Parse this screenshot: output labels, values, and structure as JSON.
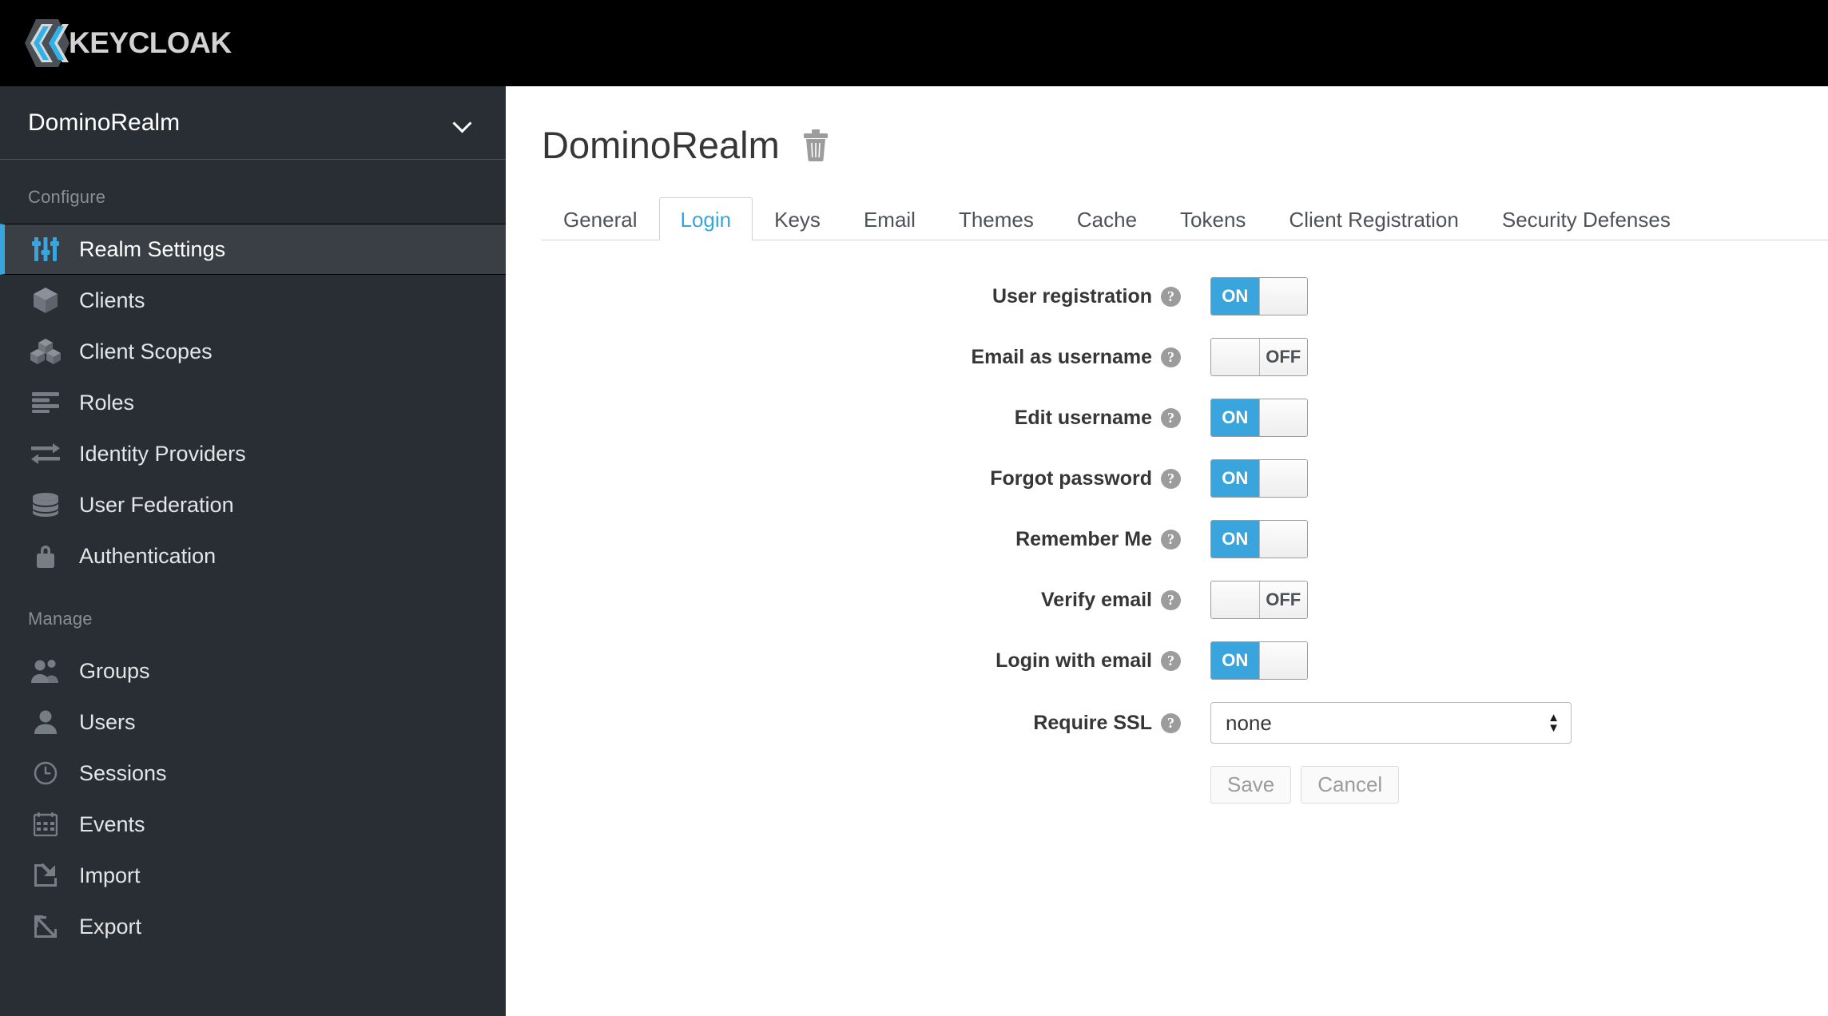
{
  "brand": {
    "name": "KEYCLOAK",
    "logo_icon": "keycloak-hexagon-logo"
  },
  "sidebar": {
    "realm_selector": {
      "label": "DominoRealm",
      "chevron_icon": "chevron-down-icon"
    },
    "sections": [
      {
        "title": "Configure",
        "items": [
          {
            "label": "Realm Settings",
            "icon": "sliders-icon",
            "active": true
          },
          {
            "label": "Clients",
            "icon": "cube-icon",
            "active": false
          },
          {
            "label": "Client Scopes",
            "icon": "cubes-icon",
            "active": false
          },
          {
            "label": "Roles",
            "icon": "list-bars-icon",
            "active": false
          },
          {
            "label": "Identity Providers",
            "icon": "exchange-arrows-icon",
            "active": false
          },
          {
            "label": "User Federation",
            "icon": "database-icon",
            "active": false
          },
          {
            "label": "Authentication",
            "icon": "lock-icon",
            "active": false
          }
        ]
      },
      {
        "title": "Manage",
        "items": [
          {
            "label": "Groups",
            "icon": "users-group-icon",
            "active": false
          },
          {
            "label": "Users",
            "icon": "user-icon",
            "active": false
          },
          {
            "label": "Sessions",
            "icon": "clock-icon",
            "active": false
          },
          {
            "label": "Events",
            "icon": "calendar-icon",
            "active": false
          },
          {
            "label": "Import",
            "icon": "import-arrow-icon",
            "active": false
          },
          {
            "label": "Export",
            "icon": "export-arrow-icon",
            "active": false
          }
        ]
      }
    ]
  },
  "main": {
    "page_title": "DominoRealm",
    "delete_icon": "trash-icon",
    "tabs": [
      {
        "label": "General",
        "active": false
      },
      {
        "label": "Login",
        "active": true
      },
      {
        "label": "Keys",
        "active": false
      },
      {
        "label": "Email",
        "active": false
      },
      {
        "label": "Themes",
        "active": false
      },
      {
        "label": "Cache",
        "active": false
      },
      {
        "label": "Tokens",
        "active": false
      },
      {
        "label": "Client Registration",
        "active": false
      },
      {
        "label": "Security Defenses",
        "active": false
      }
    ],
    "form": {
      "help_glyph": "?",
      "rows": [
        {
          "label": "User registration",
          "type": "toggle",
          "value": "ON",
          "on_label": "ON",
          "off_label": "OFF",
          "state": "on"
        },
        {
          "label": "Email as username",
          "type": "toggle",
          "value": "OFF",
          "on_label": "ON",
          "off_label": "OFF",
          "state": "off"
        },
        {
          "label": "Edit username",
          "type": "toggle",
          "value": "ON",
          "on_label": "ON",
          "off_label": "OFF",
          "state": "on"
        },
        {
          "label": "Forgot password",
          "type": "toggle",
          "value": "ON",
          "on_label": "ON",
          "off_label": "OFF",
          "state": "on"
        },
        {
          "label": "Remember Me",
          "type": "toggle",
          "value": "ON",
          "on_label": "ON",
          "off_label": "OFF",
          "state": "on"
        },
        {
          "label": "Verify email",
          "type": "toggle",
          "value": "OFF",
          "on_label": "ON",
          "off_label": "OFF",
          "state": "off"
        },
        {
          "label": "Login with email",
          "type": "toggle",
          "value": "ON",
          "on_label": "ON",
          "off_label": "OFF",
          "state": "on"
        },
        {
          "label": "Require SSL",
          "type": "select",
          "value": "none"
        }
      ],
      "save_label": "Save",
      "cancel_label": "Cancel"
    }
  },
  "colors": {
    "accent_blue": "#39a5dc",
    "sidebar_bg": "#292e34",
    "topbar_bg": "#000000",
    "active_item_bg": "#393f44"
  }
}
